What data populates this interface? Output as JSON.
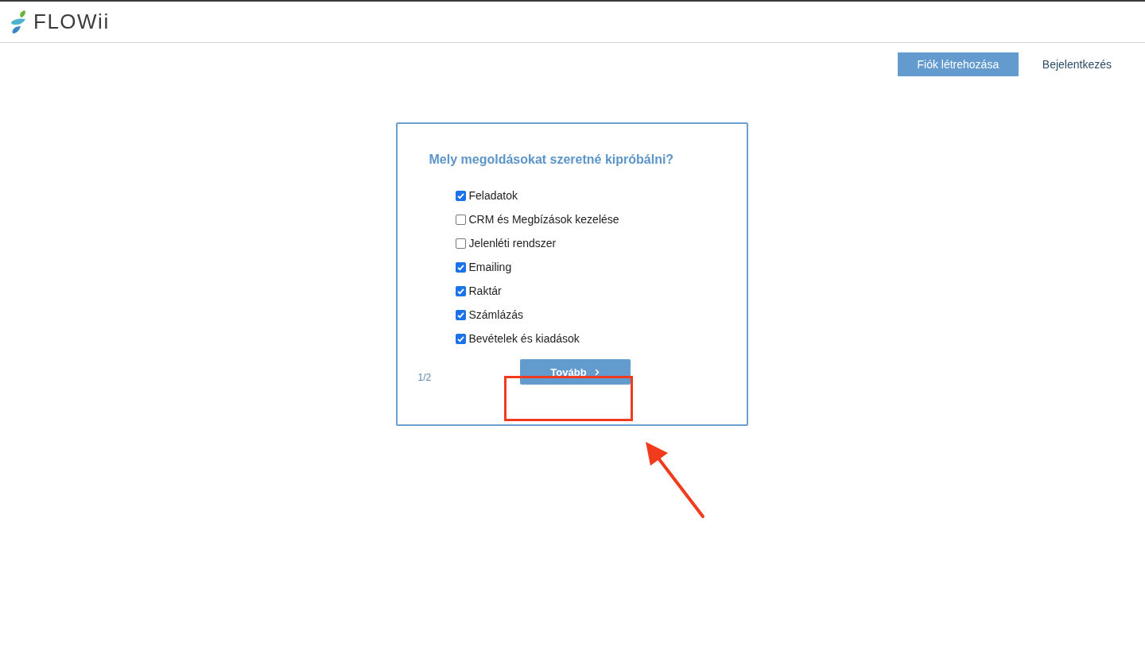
{
  "logo": {
    "text": "FLOWii"
  },
  "nav": [
    {
      "label": "Fiók létrehozása",
      "kind": "primary"
    },
    {
      "label": "Bejelentkezés",
      "kind": "link"
    }
  ],
  "card": {
    "title": "Mely megoldásokat szeretné kipróbálni?",
    "options": [
      {
        "label": "Feladatok",
        "checked": true
      },
      {
        "label": "CRM és Megbízások kezelése",
        "checked": false
      },
      {
        "label": "Jelenléti rendszer",
        "checked": false
      },
      {
        "label": "Emailing",
        "checked": true
      },
      {
        "label": "Raktár",
        "checked": true
      },
      {
        "label": "Számlázás",
        "checked": true
      },
      {
        "label": "Bevételek és kiadások",
        "checked": true
      }
    ],
    "step": "1/2",
    "next_button": "Tovább"
  }
}
